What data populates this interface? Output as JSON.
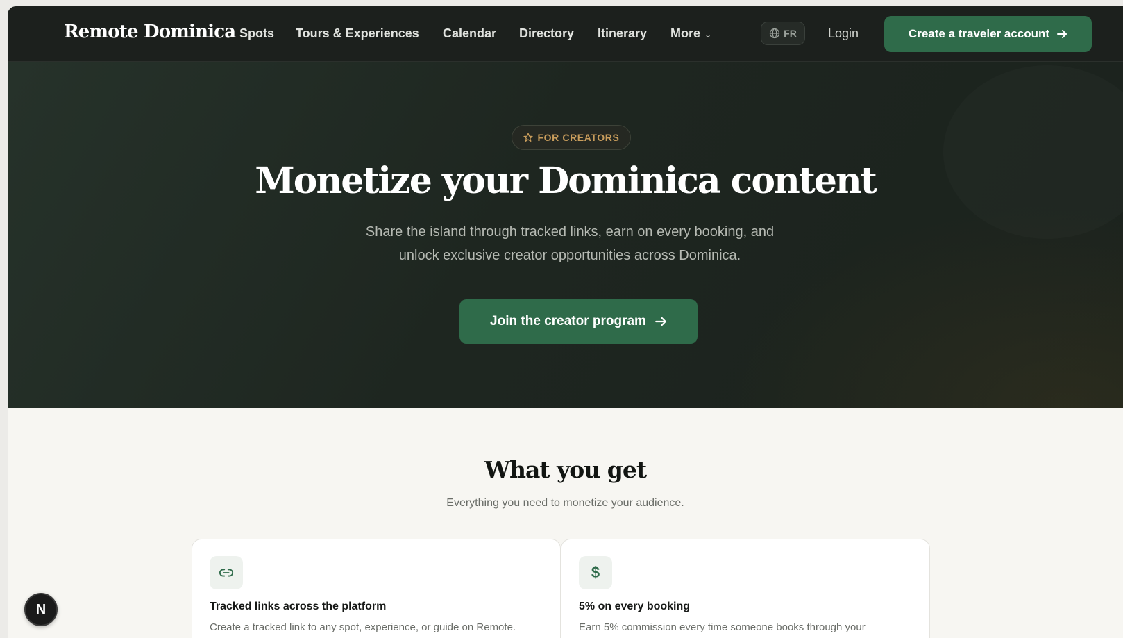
{
  "nav": {
    "brand": "Remote Dominica",
    "links": [
      "Spots",
      "Tours & Experiences",
      "Calendar",
      "Directory",
      "Itinerary"
    ],
    "more": "More",
    "lang": "FR",
    "login": "Login",
    "cta": "Create a traveler account"
  },
  "hero": {
    "badge": "FOR CREATORS",
    "title": "Monetize your Dominica content",
    "subtitle_line1": "Share the island through tracked links, earn on every booking, and",
    "subtitle_line2": "unlock exclusive creator opportunities across Dominica.",
    "cta": "Join the creator program"
  },
  "section": {
    "title": "What you get",
    "subtitle": "Everything you need to monetize your audience.",
    "cards": [
      {
        "icon": "link-icon",
        "title": "Tracked links across the platform",
        "desc": "Create a tracked link to any spot, experience, or guide on Remote."
      },
      {
        "icon": "dollar-icon",
        "title": "5% on every booking",
        "desc": "Earn 5% commission every time someone books through your"
      }
    ]
  },
  "fab": {
    "label": "N"
  },
  "colors": {
    "accent": "#2f6b4a",
    "nav_bg": "#1c201d",
    "badge_text": "#c99d5c"
  }
}
